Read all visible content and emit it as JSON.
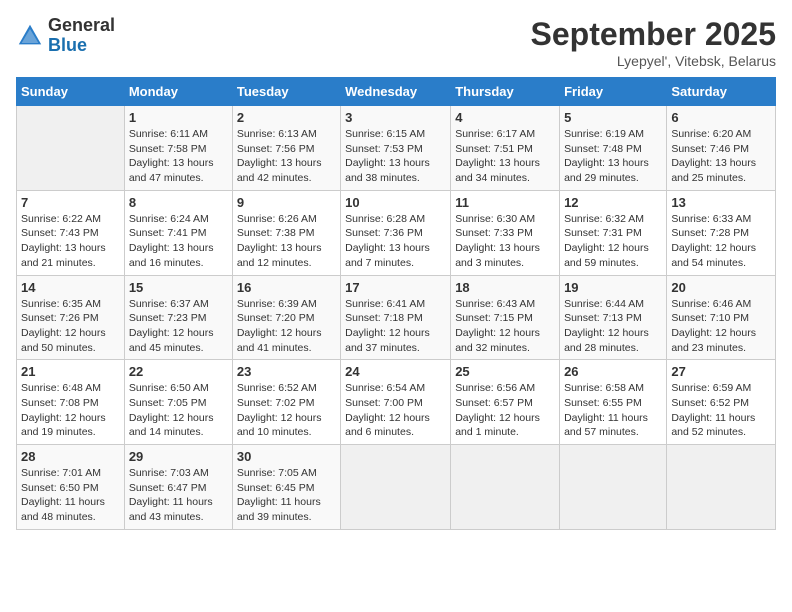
{
  "header": {
    "logo_general": "General",
    "logo_blue": "Blue",
    "month_year": "September 2025",
    "location": "Lyepyel', Vitebsk, Belarus"
  },
  "days_of_week": [
    "Sunday",
    "Monday",
    "Tuesday",
    "Wednesday",
    "Thursday",
    "Friday",
    "Saturday"
  ],
  "weeks": [
    [
      {
        "day": "",
        "info": ""
      },
      {
        "day": "1",
        "info": "Sunrise: 6:11 AM\nSunset: 7:58 PM\nDaylight: 13 hours\nand 47 minutes."
      },
      {
        "day": "2",
        "info": "Sunrise: 6:13 AM\nSunset: 7:56 PM\nDaylight: 13 hours\nand 42 minutes."
      },
      {
        "day": "3",
        "info": "Sunrise: 6:15 AM\nSunset: 7:53 PM\nDaylight: 13 hours\nand 38 minutes."
      },
      {
        "day": "4",
        "info": "Sunrise: 6:17 AM\nSunset: 7:51 PM\nDaylight: 13 hours\nand 34 minutes."
      },
      {
        "day": "5",
        "info": "Sunrise: 6:19 AM\nSunset: 7:48 PM\nDaylight: 13 hours\nand 29 minutes."
      },
      {
        "day": "6",
        "info": "Sunrise: 6:20 AM\nSunset: 7:46 PM\nDaylight: 13 hours\nand 25 minutes."
      }
    ],
    [
      {
        "day": "7",
        "info": "Sunrise: 6:22 AM\nSunset: 7:43 PM\nDaylight: 13 hours\nand 21 minutes."
      },
      {
        "day": "8",
        "info": "Sunrise: 6:24 AM\nSunset: 7:41 PM\nDaylight: 13 hours\nand 16 minutes."
      },
      {
        "day": "9",
        "info": "Sunrise: 6:26 AM\nSunset: 7:38 PM\nDaylight: 13 hours\nand 12 minutes."
      },
      {
        "day": "10",
        "info": "Sunrise: 6:28 AM\nSunset: 7:36 PM\nDaylight: 13 hours\nand 7 minutes."
      },
      {
        "day": "11",
        "info": "Sunrise: 6:30 AM\nSunset: 7:33 PM\nDaylight: 13 hours\nand 3 minutes."
      },
      {
        "day": "12",
        "info": "Sunrise: 6:32 AM\nSunset: 7:31 PM\nDaylight: 12 hours\nand 59 minutes."
      },
      {
        "day": "13",
        "info": "Sunrise: 6:33 AM\nSunset: 7:28 PM\nDaylight: 12 hours\nand 54 minutes."
      }
    ],
    [
      {
        "day": "14",
        "info": "Sunrise: 6:35 AM\nSunset: 7:26 PM\nDaylight: 12 hours\nand 50 minutes."
      },
      {
        "day": "15",
        "info": "Sunrise: 6:37 AM\nSunset: 7:23 PM\nDaylight: 12 hours\nand 45 minutes."
      },
      {
        "day": "16",
        "info": "Sunrise: 6:39 AM\nSunset: 7:20 PM\nDaylight: 12 hours\nand 41 minutes."
      },
      {
        "day": "17",
        "info": "Sunrise: 6:41 AM\nSunset: 7:18 PM\nDaylight: 12 hours\nand 37 minutes."
      },
      {
        "day": "18",
        "info": "Sunrise: 6:43 AM\nSunset: 7:15 PM\nDaylight: 12 hours\nand 32 minutes."
      },
      {
        "day": "19",
        "info": "Sunrise: 6:44 AM\nSunset: 7:13 PM\nDaylight: 12 hours\nand 28 minutes."
      },
      {
        "day": "20",
        "info": "Sunrise: 6:46 AM\nSunset: 7:10 PM\nDaylight: 12 hours\nand 23 minutes."
      }
    ],
    [
      {
        "day": "21",
        "info": "Sunrise: 6:48 AM\nSunset: 7:08 PM\nDaylight: 12 hours\nand 19 minutes."
      },
      {
        "day": "22",
        "info": "Sunrise: 6:50 AM\nSunset: 7:05 PM\nDaylight: 12 hours\nand 14 minutes."
      },
      {
        "day": "23",
        "info": "Sunrise: 6:52 AM\nSunset: 7:02 PM\nDaylight: 12 hours\nand 10 minutes."
      },
      {
        "day": "24",
        "info": "Sunrise: 6:54 AM\nSunset: 7:00 PM\nDaylight: 12 hours\nand 6 minutes."
      },
      {
        "day": "25",
        "info": "Sunrise: 6:56 AM\nSunset: 6:57 PM\nDaylight: 12 hours\nand 1 minute."
      },
      {
        "day": "26",
        "info": "Sunrise: 6:58 AM\nSunset: 6:55 PM\nDaylight: 11 hours\nand 57 minutes."
      },
      {
        "day": "27",
        "info": "Sunrise: 6:59 AM\nSunset: 6:52 PM\nDaylight: 11 hours\nand 52 minutes."
      }
    ],
    [
      {
        "day": "28",
        "info": "Sunrise: 7:01 AM\nSunset: 6:50 PM\nDaylight: 11 hours\nand 48 minutes."
      },
      {
        "day": "29",
        "info": "Sunrise: 7:03 AM\nSunset: 6:47 PM\nDaylight: 11 hours\nand 43 minutes."
      },
      {
        "day": "30",
        "info": "Sunrise: 7:05 AM\nSunset: 6:45 PM\nDaylight: 11 hours\nand 39 minutes."
      },
      {
        "day": "",
        "info": ""
      },
      {
        "day": "",
        "info": ""
      },
      {
        "day": "",
        "info": ""
      },
      {
        "day": "",
        "info": ""
      }
    ]
  ]
}
